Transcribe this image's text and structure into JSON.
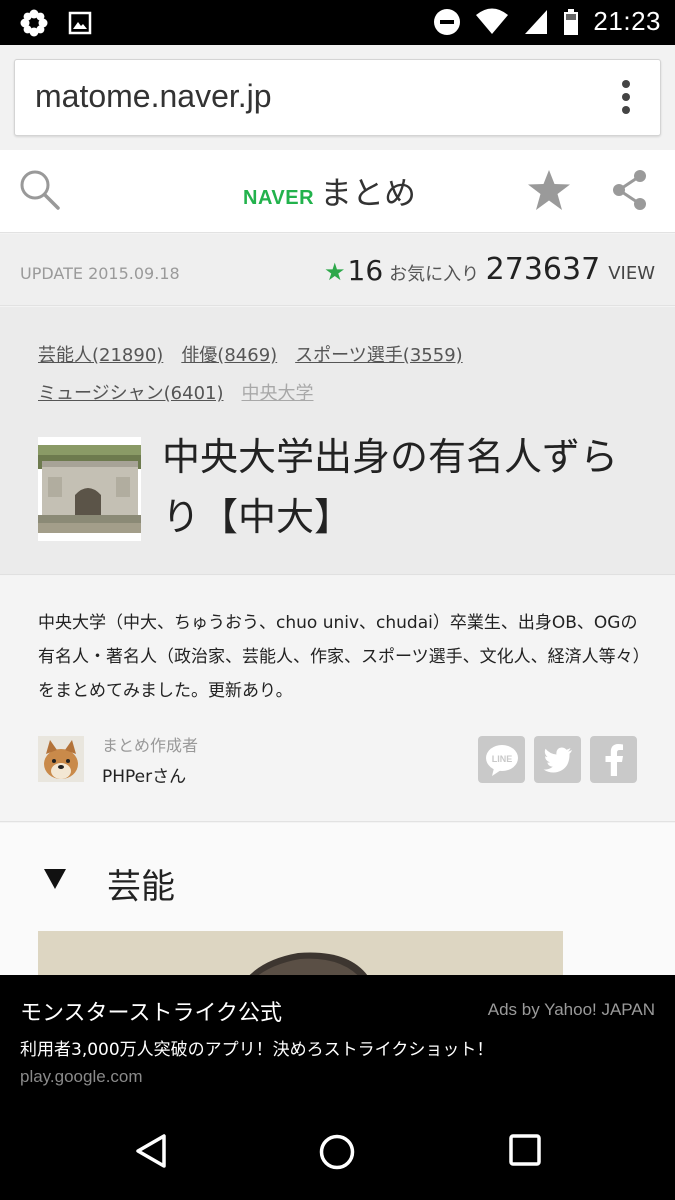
{
  "status_bar": {
    "time": "21:23"
  },
  "url_bar": {
    "url": "matome.naver.jp"
  },
  "header": {
    "brand_naver": "NAVER",
    "brand_matome": "まとめ"
  },
  "meta": {
    "update": "UPDATE 2015.09.18",
    "favorites_count": "16",
    "favorites_label": "お気に入り",
    "views_count": "273637",
    "views_label": "VIEW"
  },
  "tags": [
    {
      "label": "芸能人(21890)"
    },
    {
      "label": "俳優(8469)"
    },
    {
      "label": "スポーツ選手(3559)"
    },
    {
      "label": "ミュージシャン(6401)"
    },
    {
      "label": "中央大学"
    }
  ],
  "article": {
    "title": "中央大学出身の有名人ずらり【中大】",
    "description": "中央大学（中大、ちゅうおう、chuo univ、chudai）卒業生、出身OB、OGの有名人・著名人（政治家、芸能人、作家、スポーツ選手、文化人、経済人等々）をまとめてみました。更新あり。",
    "author_role": "まとめ作成者",
    "author_name": "PHPerさん"
  },
  "social": {
    "line_label": "LINE"
  },
  "section": {
    "heading": "芸能"
  },
  "ad": {
    "title": "モンスターストライク公式",
    "by": "Ads by Yahoo! JAPAN",
    "desc": "利用者3,000万人突破のアプリ！決めろストライクショット！",
    "url": "play.google.com"
  },
  "colors": {
    "brand_green": "#22b24c",
    "star_green": "#2da84a",
    "social_grey": "#c9c9c9"
  }
}
